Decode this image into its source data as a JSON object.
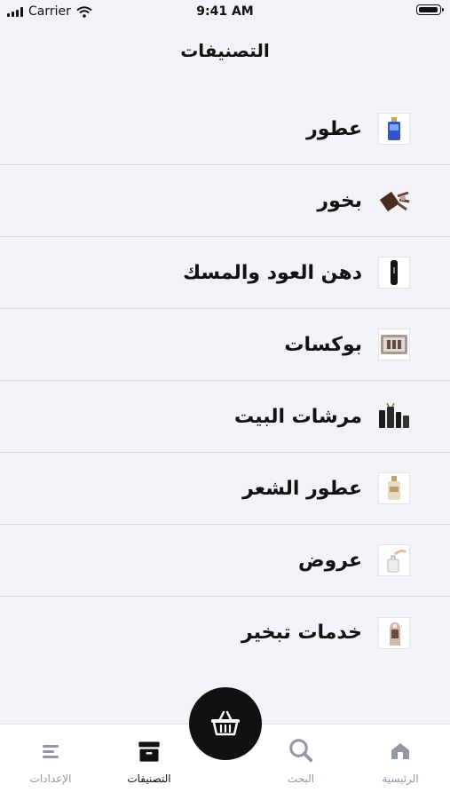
{
  "status_bar": {
    "carrier": "Carrier",
    "time": "9:41 AM",
    "battery_level": 1.0
  },
  "page": {
    "title": "التصنيفات"
  },
  "categories": [
    {
      "label": "عطور",
      "icon": "perfume-bottle-icon"
    },
    {
      "label": "بخور",
      "icon": "incense-icon"
    },
    {
      "label": "دهن العود والمسك",
      "icon": "oil-vial-icon"
    },
    {
      "label": "بوكسات",
      "icon": "gift-box-icon"
    },
    {
      "label": "مرشات البيت",
      "icon": "home-spray-icon"
    },
    {
      "label": "عطور الشعر",
      "icon": "hair-mist-icon"
    },
    {
      "label": "عروض",
      "icon": "offers-icon"
    },
    {
      "label": "خدمات تبخير",
      "icon": "fumigation-service-icon"
    }
  ],
  "tab_bar": {
    "tabs": [
      {
        "label": "الرئيسية",
        "icon": "home-icon"
      },
      {
        "label": "البحث",
        "icon": "search-icon"
      },
      {
        "label": "التصنيفات",
        "icon": "categories-icon",
        "active": true
      },
      {
        "label": "الإعدادات",
        "icon": "settings-icon"
      }
    ],
    "cart_icon": "basket-icon"
  },
  "colors": {
    "accent": "#111111",
    "inactive": "#9297a5",
    "background": "#f2f3f7"
  }
}
